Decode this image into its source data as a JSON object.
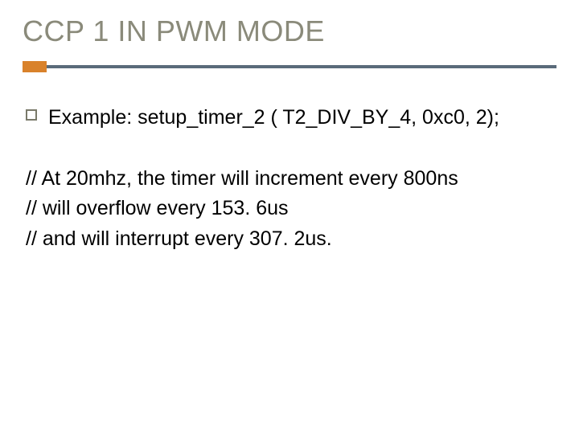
{
  "slide": {
    "title": "CCP 1 IN PWM MODE",
    "bullet": {
      "text": "Example: setup_timer_2 ( T2_DIV_BY_4, 0xc0, 2);"
    },
    "comments": {
      "line1": "// At 20mhz, the timer will increment every 800ns",
      "line2": "// will overflow every 153. 6us",
      "line3": "// and will interrupt every 307. 2us."
    }
  }
}
